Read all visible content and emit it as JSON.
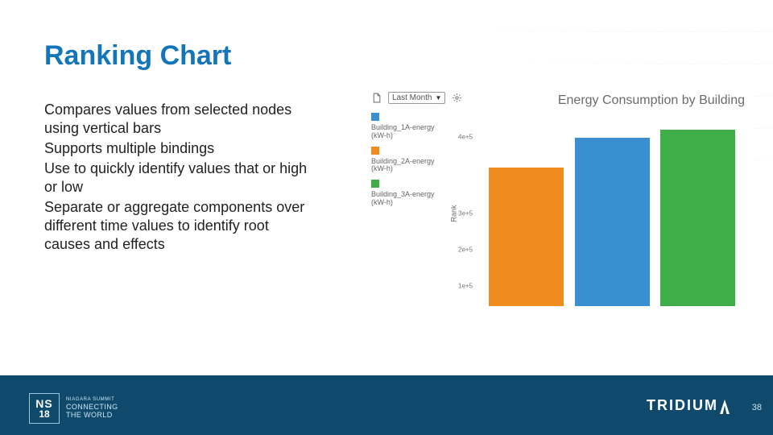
{
  "title": "Ranking Chart",
  "body": {
    "p1": "Compares values from selected nodes using vertical bars",
    "p2": "Supports multiple bindings",
    "p3": "Use to quickly identify values that or high or low",
    "p4": "Separate or aggregate components over different time values to identify root causes and effects"
  },
  "widget": {
    "time_label": "Last Month",
    "chart_title": "Energy Consumption by Building",
    "legend": [
      {
        "label_l1": "Building_1A-energy",
        "label_l2": "(kW-h)",
        "color": "#3a8fd0"
      },
      {
        "label_l1": "Building_2A-energy",
        "label_l2": "(kW-h)",
        "color": "#f08b1d"
      },
      {
        "label_l1": "Building_3A-energy",
        "label_l2": "(kW-h)",
        "color": "#3fae49"
      }
    ],
    "ylabel": "Rank",
    "yticks": [
      "4e+5",
      "3e+5",
      "2e+5",
      "1e+5"
    ]
  },
  "chart_data": {
    "type": "bar",
    "title": "Energy Consumption by Building",
    "xlabel": "",
    "ylabel": "Rank",
    "categories": [
      "Building_2A-energy (kW-h)",
      "Building_1A-energy (kW-h)",
      "Building_3A-energy (kW-h)"
    ],
    "values": [
      330000,
      400000,
      420000
    ],
    "colors": [
      "#f08b1d",
      "#3a8fd0",
      "#3fae49"
    ],
    "ylim": [
      0,
      450000
    ],
    "ytick_values": [
      100000,
      200000,
      300000,
      400000
    ],
    "ytick_labels": [
      "1e+5",
      "2e+5",
      "3e+5",
      "4e+5"
    ]
  },
  "footer": {
    "badge_top": "NS",
    "badge_bottom": "18",
    "text_tiny": "NIAGARA SUMMIT",
    "text_l1": "CONNECTING",
    "text_l2": "THE WORLD",
    "brand": "TRIDIUM",
    "page": "38"
  },
  "colors": {
    "title": "#1476b8",
    "footer": "#0f4a6d"
  }
}
